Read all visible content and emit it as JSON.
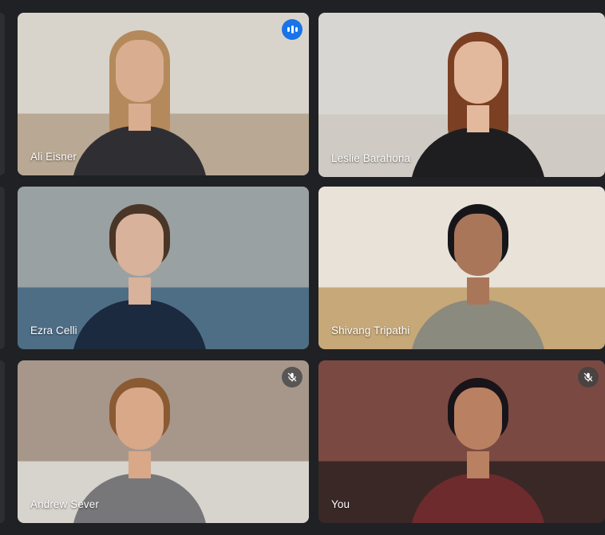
{
  "participants": [
    {
      "name": "Ali Eisner",
      "status": "speaking",
      "active": true,
      "scene": {
        "wall": "#d9d4cb",
        "floor": "#b9a893",
        "shirt": "#2f2f33",
        "hair": "#b48a5c",
        "skin": "#d9ad8f"
      }
    },
    {
      "name": "Leslie Barahona",
      "status": "none",
      "active": false,
      "scene": {
        "wall": "#d8d6d2",
        "floor": "#cfcac3",
        "shirt": "#1e1e20",
        "hair": "#7b3f23",
        "skin": "#e3b99d"
      }
    },
    {
      "name": "Ezra Celli",
      "status": "none",
      "active": false,
      "scene": {
        "wall": "#9aa1a3",
        "floor": "#4e6e86",
        "shirt": "#1b2a3e",
        "hair": "#4a3627",
        "skin": "#d8b29a"
      }
    },
    {
      "name": "Shivang Tripathi",
      "status": "none",
      "active": false,
      "scene": {
        "wall": "#e8e2d8",
        "floor": "#c7a878",
        "shirt": "#8a8a7e",
        "hair": "#16161a",
        "skin": "#a9765a"
      }
    },
    {
      "name": "Andrew Sever",
      "status": "muted",
      "active": false,
      "scene": {
        "wall": "#a7978a",
        "floor": "#d7d3cd",
        "shirt": "#77777a",
        "hair": "#8a5a33",
        "skin": "#d8a889"
      }
    },
    {
      "name": "You",
      "status": "muted",
      "active": false,
      "scene": {
        "wall": "#7a4a42",
        "floor": "#3a2826",
        "shirt": "#6d2b2e",
        "hair": "#181419",
        "skin": "#b98062"
      }
    }
  ],
  "icons": {
    "speaking": "audio-level-icon",
    "muted": "mic-off-icon"
  }
}
